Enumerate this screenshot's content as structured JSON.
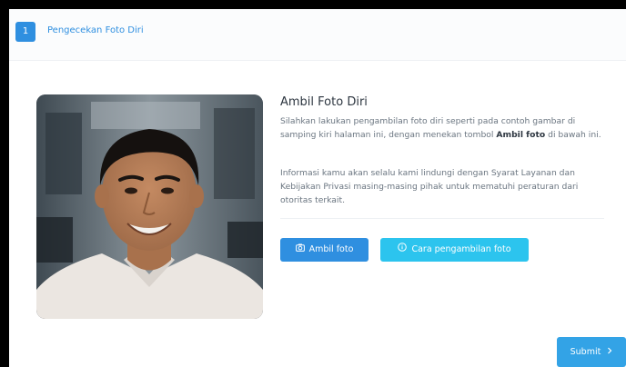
{
  "header": {
    "step_number": "1",
    "step_title": "Pengecekan Foto Diri"
  },
  "main": {
    "title": "Ambil Foto Diri",
    "instruction_before": "Silahkan lakukan pengambilan foto diri seperti pada contoh gambar di samping kiri halaman ini, dengan menekan tombol ",
    "instruction_bold": "Ambil foto",
    "instruction_after": " di bawah ini.",
    "privacy_text": "Informasi kamu akan selalu kami lindungi dengan Syarat Layanan dan Kebijakan Privasi masing-masing pihak untuk mematuhi peraturan dari otoritas terkait.",
    "take_photo_label": "Ambil foto",
    "take_photo_icon": "camera-icon",
    "howto_label": "Cara pengambilan foto",
    "howto_icon": "info-circle-icon"
  },
  "footer": {
    "submit_label": "Submit",
    "submit_icon": "chevron-right-icon"
  },
  "colors": {
    "primary": "#2f8fe0",
    "secondary": "#2cc4ee",
    "submit": "#33a3e6",
    "heading": "#2d3640",
    "body_text": "#6a7580"
  }
}
